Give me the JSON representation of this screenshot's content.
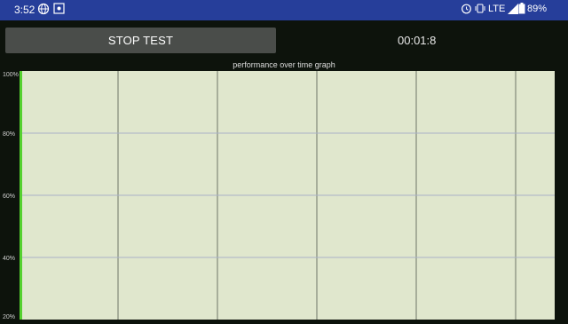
{
  "status_bar": {
    "time": "3:52",
    "network": "LTE",
    "battery": "89%",
    "bg_color": "#263e9a",
    "icons": [
      "globe-icon",
      "crosshair-icon",
      "alarm-icon",
      "vibrate-icon",
      "signal-icon",
      "battery-icon"
    ]
  },
  "controls": {
    "stop_label": "STOP TEST",
    "timer": "00:01:8"
  },
  "graph": {
    "title": "performance over time graph",
    "y_ticks": [
      "100%",
      "80%",
      "60%",
      "40%",
      "20%"
    ],
    "bg_color": "#e0e7cd",
    "line_color": "#55d12f"
  },
  "chart_data": {
    "type": "line",
    "title": "performance over time graph",
    "ylim": [
      20,
      100
    ],
    "y_ticks": [
      "100%",
      "80%",
      "60%",
      "40%",
      "20%"
    ],
    "grid": true,
    "series": [
      {
        "values": [
          100,
          20
        ]
      }
    ]
  }
}
